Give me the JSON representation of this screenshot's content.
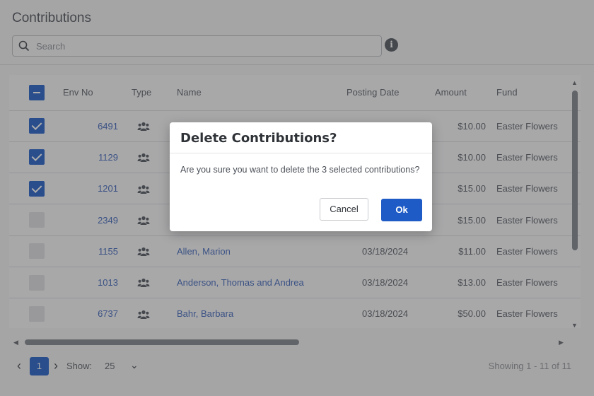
{
  "page": {
    "title": "Contributions",
    "search_placeholder": "Search",
    "info_glyph": "i"
  },
  "table": {
    "columns": [
      "Env No",
      "Type",
      "Name",
      "Posting Date",
      "Amount",
      "Fund"
    ],
    "rows": [
      {
        "checked": true,
        "env": "6491",
        "name": "",
        "date": "",
        "amount": "$10.00",
        "fund": "Easter Flowers"
      },
      {
        "checked": true,
        "env": "1129",
        "name": "",
        "date": "",
        "amount": "$10.00",
        "fund": "Easter Flowers"
      },
      {
        "checked": true,
        "env": "1201",
        "name": "",
        "date": "",
        "amount": "$15.00",
        "fund": "Easter Flowers"
      },
      {
        "checked": false,
        "env": "2349",
        "name": "",
        "date": "",
        "amount": "$15.00",
        "fund": "Easter Flowers"
      },
      {
        "checked": false,
        "env": "1155",
        "name": "Allen, Marion",
        "date": "03/18/2024",
        "amount": "$11.00",
        "fund": "Easter Flowers"
      },
      {
        "checked": false,
        "env": "1013",
        "name": "Anderson, Thomas and Andrea",
        "date": "03/18/2024",
        "amount": "$13.00",
        "fund": "Easter Flowers"
      },
      {
        "checked": false,
        "env": "6737",
        "name": "Bahr, Barbara",
        "date": "03/18/2024",
        "amount": "$50.00",
        "fund": "Easter Flowers"
      }
    ]
  },
  "pager": {
    "prev": "‹",
    "page": "1",
    "next": "›",
    "show_label": "Show:",
    "show_value": "25",
    "chevron": "⌄",
    "showing": "Showing 1 - 11 of 11"
  },
  "scroll": {
    "up": "▲",
    "down": "▼",
    "left": "◀",
    "right": "▶"
  },
  "dialog": {
    "title": "Delete Contributions?",
    "message": "Are you sure you want to delete the 3 selected contributions?",
    "cancel": "Cancel",
    "ok": "Ok"
  },
  "colors": {
    "accent": "#1e5bc6",
    "link": "#3b62b8",
    "overlay": "rgba(60,60,60,0.42)"
  }
}
